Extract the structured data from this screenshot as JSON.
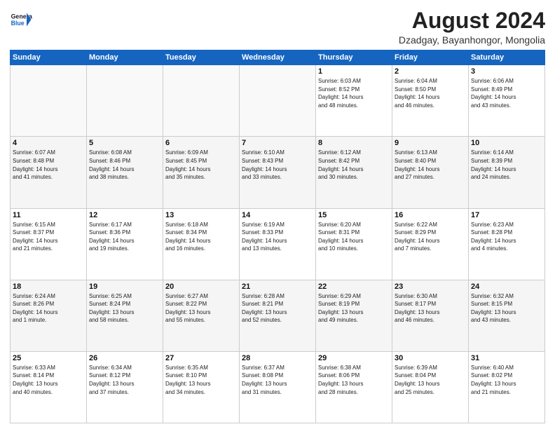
{
  "header": {
    "logo_general": "General",
    "logo_blue": "Blue",
    "month_year": "August 2024",
    "location": "Dzadgay, Bayanhongor, Mongolia"
  },
  "days_of_week": [
    "Sunday",
    "Monday",
    "Tuesday",
    "Wednesday",
    "Thursday",
    "Friday",
    "Saturday"
  ],
  "weeks": [
    [
      {
        "day": "",
        "info": ""
      },
      {
        "day": "",
        "info": ""
      },
      {
        "day": "",
        "info": ""
      },
      {
        "day": "",
        "info": ""
      },
      {
        "day": "1",
        "info": "Sunrise: 6:03 AM\nSunset: 8:52 PM\nDaylight: 14 hours\nand 48 minutes."
      },
      {
        "day": "2",
        "info": "Sunrise: 6:04 AM\nSunset: 8:50 PM\nDaylight: 14 hours\nand 46 minutes."
      },
      {
        "day": "3",
        "info": "Sunrise: 6:06 AM\nSunset: 8:49 PM\nDaylight: 14 hours\nand 43 minutes."
      }
    ],
    [
      {
        "day": "4",
        "info": "Sunrise: 6:07 AM\nSunset: 8:48 PM\nDaylight: 14 hours\nand 41 minutes."
      },
      {
        "day": "5",
        "info": "Sunrise: 6:08 AM\nSunset: 8:46 PM\nDaylight: 14 hours\nand 38 minutes."
      },
      {
        "day": "6",
        "info": "Sunrise: 6:09 AM\nSunset: 8:45 PM\nDaylight: 14 hours\nand 35 minutes."
      },
      {
        "day": "7",
        "info": "Sunrise: 6:10 AM\nSunset: 8:43 PM\nDaylight: 14 hours\nand 33 minutes."
      },
      {
        "day": "8",
        "info": "Sunrise: 6:12 AM\nSunset: 8:42 PM\nDaylight: 14 hours\nand 30 minutes."
      },
      {
        "day": "9",
        "info": "Sunrise: 6:13 AM\nSunset: 8:40 PM\nDaylight: 14 hours\nand 27 minutes."
      },
      {
        "day": "10",
        "info": "Sunrise: 6:14 AM\nSunset: 8:39 PM\nDaylight: 14 hours\nand 24 minutes."
      }
    ],
    [
      {
        "day": "11",
        "info": "Sunrise: 6:15 AM\nSunset: 8:37 PM\nDaylight: 14 hours\nand 21 minutes."
      },
      {
        "day": "12",
        "info": "Sunrise: 6:17 AM\nSunset: 8:36 PM\nDaylight: 14 hours\nand 19 minutes."
      },
      {
        "day": "13",
        "info": "Sunrise: 6:18 AM\nSunset: 8:34 PM\nDaylight: 14 hours\nand 16 minutes."
      },
      {
        "day": "14",
        "info": "Sunrise: 6:19 AM\nSunset: 8:33 PM\nDaylight: 14 hours\nand 13 minutes."
      },
      {
        "day": "15",
        "info": "Sunrise: 6:20 AM\nSunset: 8:31 PM\nDaylight: 14 hours\nand 10 minutes."
      },
      {
        "day": "16",
        "info": "Sunrise: 6:22 AM\nSunset: 8:29 PM\nDaylight: 14 hours\nand 7 minutes."
      },
      {
        "day": "17",
        "info": "Sunrise: 6:23 AM\nSunset: 8:28 PM\nDaylight: 14 hours\nand 4 minutes."
      }
    ],
    [
      {
        "day": "18",
        "info": "Sunrise: 6:24 AM\nSunset: 8:26 PM\nDaylight: 14 hours\nand 1 minute."
      },
      {
        "day": "19",
        "info": "Sunrise: 6:25 AM\nSunset: 8:24 PM\nDaylight: 13 hours\nand 58 minutes."
      },
      {
        "day": "20",
        "info": "Sunrise: 6:27 AM\nSunset: 8:22 PM\nDaylight: 13 hours\nand 55 minutes."
      },
      {
        "day": "21",
        "info": "Sunrise: 6:28 AM\nSunset: 8:21 PM\nDaylight: 13 hours\nand 52 minutes."
      },
      {
        "day": "22",
        "info": "Sunrise: 6:29 AM\nSunset: 8:19 PM\nDaylight: 13 hours\nand 49 minutes."
      },
      {
        "day": "23",
        "info": "Sunrise: 6:30 AM\nSunset: 8:17 PM\nDaylight: 13 hours\nand 46 minutes."
      },
      {
        "day": "24",
        "info": "Sunrise: 6:32 AM\nSunset: 8:15 PM\nDaylight: 13 hours\nand 43 minutes."
      }
    ],
    [
      {
        "day": "25",
        "info": "Sunrise: 6:33 AM\nSunset: 8:14 PM\nDaylight: 13 hours\nand 40 minutes."
      },
      {
        "day": "26",
        "info": "Sunrise: 6:34 AM\nSunset: 8:12 PM\nDaylight: 13 hours\nand 37 minutes."
      },
      {
        "day": "27",
        "info": "Sunrise: 6:35 AM\nSunset: 8:10 PM\nDaylight: 13 hours\nand 34 minutes."
      },
      {
        "day": "28",
        "info": "Sunrise: 6:37 AM\nSunset: 8:08 PM\nDaylight: 13 hours\nand 31 minutes."
      },
      {
        "day": "29",
        "info": "Sunrise: 6:38 AM\nSunset: 8:06 PM\nDaylight: 13 hours\nand 28 minutes."
      },
      {
        "day": "30",
        "info": "Sunrise: 6:39 AM\nSunset: 8:04 PM\nDaylight: 13 hours\nand 25 minutes."
      },
      {
        "day": "31",
        "info": "Sunrise: 6:40 AM\nSunset: 8:02 PM\nDaylight: 13 hours\nand 21 minutes."
      }
    ]
  ]
}
